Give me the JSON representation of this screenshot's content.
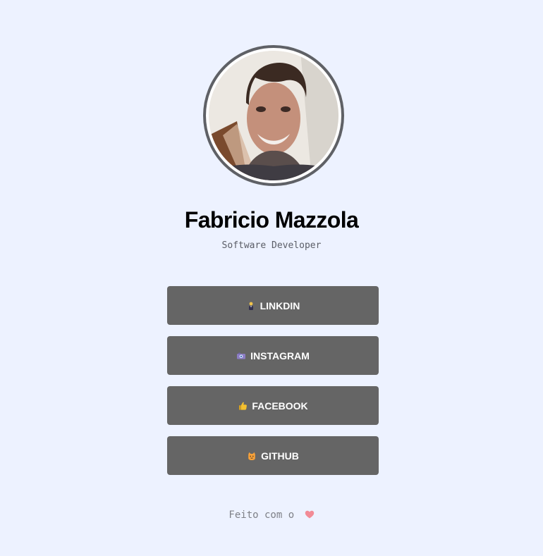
{
  "profile": {
    "name": "Fabricio Mazzola",
    "role": "Software Developer"
  },
  "links": [
    {
      "label": "LINKDIN",
      "icon": "person-in-suit-icon"
    },
    {
      "label": "INSTAGRAM",
      "icon": "camera-icon"
    },
    {
      "label": "FACEBOOK",
      "icon": "thumbs-up-icon"
    },
    {
      "label": "GITHUB",
      "icon": "cat-icon"
    }
  ],
  "footer": {
    "text": "Feito com o",
    "icon": "heart-icon"
  },
  "colors": {
    "background": "#edf2ff",
    "button": "#656565",
    "heart": "#f28b96"
  }
}
